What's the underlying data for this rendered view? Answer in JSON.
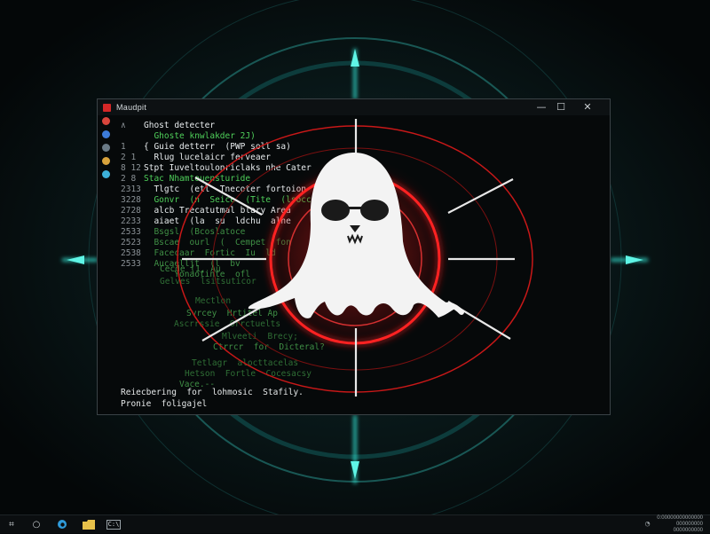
{
  "window": {
    "title": "Maudpit",
    "controls": {
      "minimize": "—",
      "maximize": "☐",
      "close": "✕"
    }
  },
  "gutter_icons": [
    {
      "name": "alert-icon",
      "color": "#d9453c"
    },
    {
      "name": "shield-icon",
      "color": "#3c7bd9"
    },
    {
      "name": "eye-icon",
      "color": "#6a7a86"
    },
    {
      "name": "chrome-icon",
      "color": "#d9a33c"
    },
    {
      "name": "edge-icon",
      "color": "#3cb0d9"
    }
  ],
  "code_lines": [
    {
      "num": "∧",
      "text": "Ghost detecter",
      "color": "white"
    },
    {
      "num": "",
      "text": "  Ghoste knwlakder 2J)",
      "color": "green"
    },
    {
      "num": "1",
      "text": "{ Guie detterr  (PWP soll sa)",
      "color": "white"
    },
    {
      "num": "2 1",
      "text": "  Rlug lucelaicr ferveaer",
      "color": "white"
    },
    {
      "num": "8 12",
      "text": "Stpt Iuveltoulonriclaks nhe Cater",
      "color": "white"
    },
    {
      "num": "2 8",
      "text": "Stac Nhamtouensturide",
      "color": "green"
    },
    {
      "num": "2313",
      "text": "  Tlgtc  (etl  Tnecoter fortoion",
      "color": "white"
    },
    {
      "num": "3228",
      "text": "  Gonvr  (n  Seice  (Tite  (lsocce",
      "color": "green"
    },
    {
      "num": "2728",
      "text": "  alcb Trecatutmal blary Area",
      "color": "white"
    },
    {
      "num": "2233",
      "text": "  aiaet  (la  su  ldchu  alne",
      "color": "white"
    },
    {
      "num": "2533",
      "text": "  Bsgsl  (Bcoslatoce",
      "color": "dim"
    },
    {
      "num": "2523",
      "text": "  Bscae  ourl  (  Cempet  fon",
      "color": "dim"
    },
    {
      "num": "2538",
      "text": "  Facecaar  Fortic  Iu  ld",
      "color": "dim"
    },
    {
      "num": "2533",
      "text": "  Aucaelljt  (l  bv",
      "color": "dim"
    },
    {
      "num": "",
      "text": "      Yonaotinte  ofl",
      "color": "dim"
    }
  ],
  "faded_lines": [
    "Cecde (1, Au",
    "Gelves  lsitsuticor",
    "Mectlon",
    "Svrcey  Hrtitel Ap",
    "Ascrrssie  Orrctuelts",
    "Mlveeti  Brecy;",
    "Ctrrcr  for  Dicteral?",
    "Tetlagr  alocttacelas",
    "Hetson  Fortle  Cocesacsy",
    "Vace.--"
  ],
  "status": {
    "line1": "Reiecbering  for  lohmosic  Stafily.",
    "line2": "Pronie  foligajel"
  },
  "taskbar": {
    "start_glyph": "⌗",
    "search_glyph": "○",
    "terminal_label": "C:\\",
    "clock_line1": "0:00000000000000",
    "clock_line2": "000000000",
    "clock_line3": "0000000000"
  },
  "colors": {
    "accent_teal": "#2fe6d4",
    "ghost_red": "#e31d1d",
    "ghost_white": "#f2f2f2",
    "code_green": "#4fcf5a"
  }
}
